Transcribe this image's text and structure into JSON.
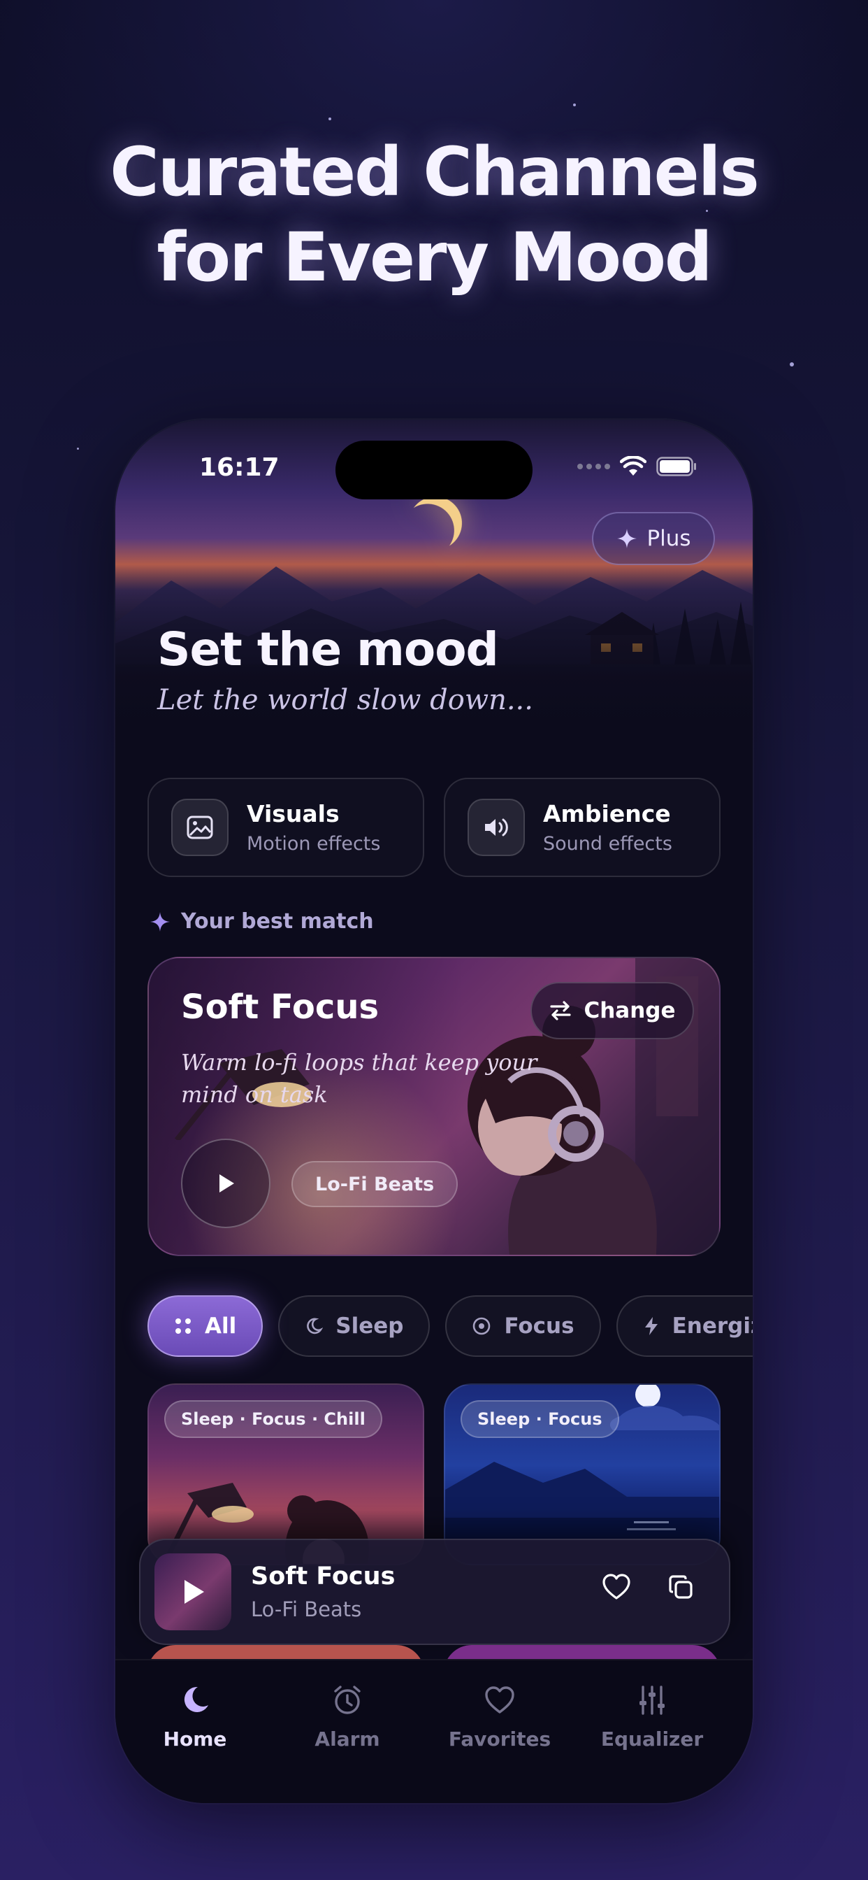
{
  "marketing": {
    "headline_line1": "Curated Channels",
    "headline_line2": "for Every Mood"
  },
  "status_bar": {
    "time": "16:17"
  },
  "hero": {
    "plus_label": "Plus",
    "title": "Set the mood",
    "subtitle": "Let the world slow down..."
  },
  "features": [
    {
      "title": "Visuals",
      "subtitle": "Motion effects",
      "icon": "image-icon"
    },
    {
      "title": "Ambience",
      "subtitle": "Sound effects",
      "icon": "speaker-icon"
    }
  ],
  "best_match": {
    "label": "Your best match",
    "title": "Soft Focus",
    "description": "Warm lo-fi loops that keep your mind on task",
    "change_label": "Change",
    "tag": "Lo-Fi Beats"
  },
  "filters": [
    {
      "label": "All",
      "icon": "grid-dots-icon",
      "active": true
    },
    {
      "label": "Sleep",
      "icon": "moon-icon",
      "active": false
    },
    {
      "label": "Focus",
      "icon": "target-icon",
      "active": false
    },
    {
      "label": "Energize",
      "icon": "bolt-icon",
      "active": false
    }
  ],
  "tiles": [
    {
      "tags": "Sleep · Focus · Chill"
    },
    {
      "tags": "Sleep · Focus"
    }
  ],
  "now_playing": {
    "title": "Soft Focus",
    "subtitle": "Lo-Fi Beats"
  },
  "tabs": [
    {
      "label": "Home",
      "icon": "moon-icon",
      "active": true
    },
    {
      "label": "Alarm",
      "icon": "alarm-clock-icon",
      "active": false
    },
    {
      "label": "Favorites",
      "icon": "heart-icon",
      "active": false
    },
    {
      "label": "Equalizer",
      "icon": "equalizer-icon",
      "active": false
    }
  ],
  "colors": {
    "accent": "#8c6ad6",
    "background": "#0c0b1c",
    "page_background": "#17163a"
  }
}
